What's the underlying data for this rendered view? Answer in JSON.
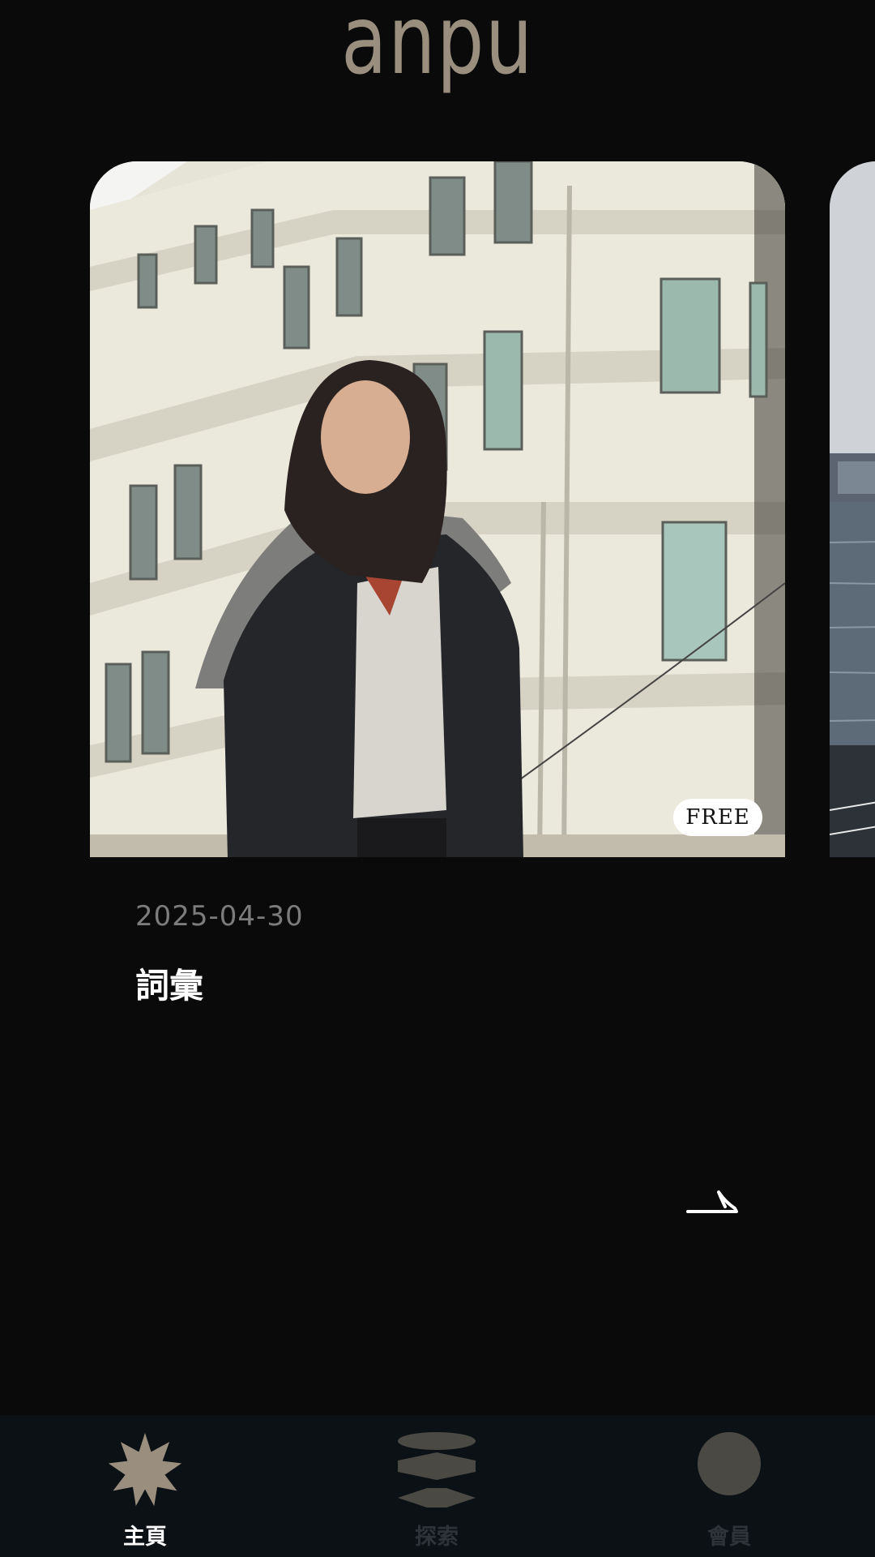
{
  "app": {
    "logo_text": "anpu",
    "logo_color": "#9a8f7f",
    "background": "#0a0a0a"
  },
  "feed": {
    "current_card": {
      "badge": "FREE",
      "date": "2025-04-30",
      "title": "詞彙",
      "photo_subject": "woman in dark coat in front of white building"
    },
    "next_card": {
      "photo_subject": "harbor and water"
    }
  },
  "tabbar": {
    "background": "#0c1115",
    "tabs": [
      {
        "label": "主頁",
        "icon": "starburst-icon",
        "active": true
      },
      {
        "label": "探索",
        "icon": "layers-icon",
        "active": false
      },
      {
        "label": "會員",
        "icon": "circle-icon",
        "active": false
      }
    ],
    "active_color": "#ffffff",
    "inactive_color": "#2c343a",
    "icon_color": "#9a8f7f"
  }
}
